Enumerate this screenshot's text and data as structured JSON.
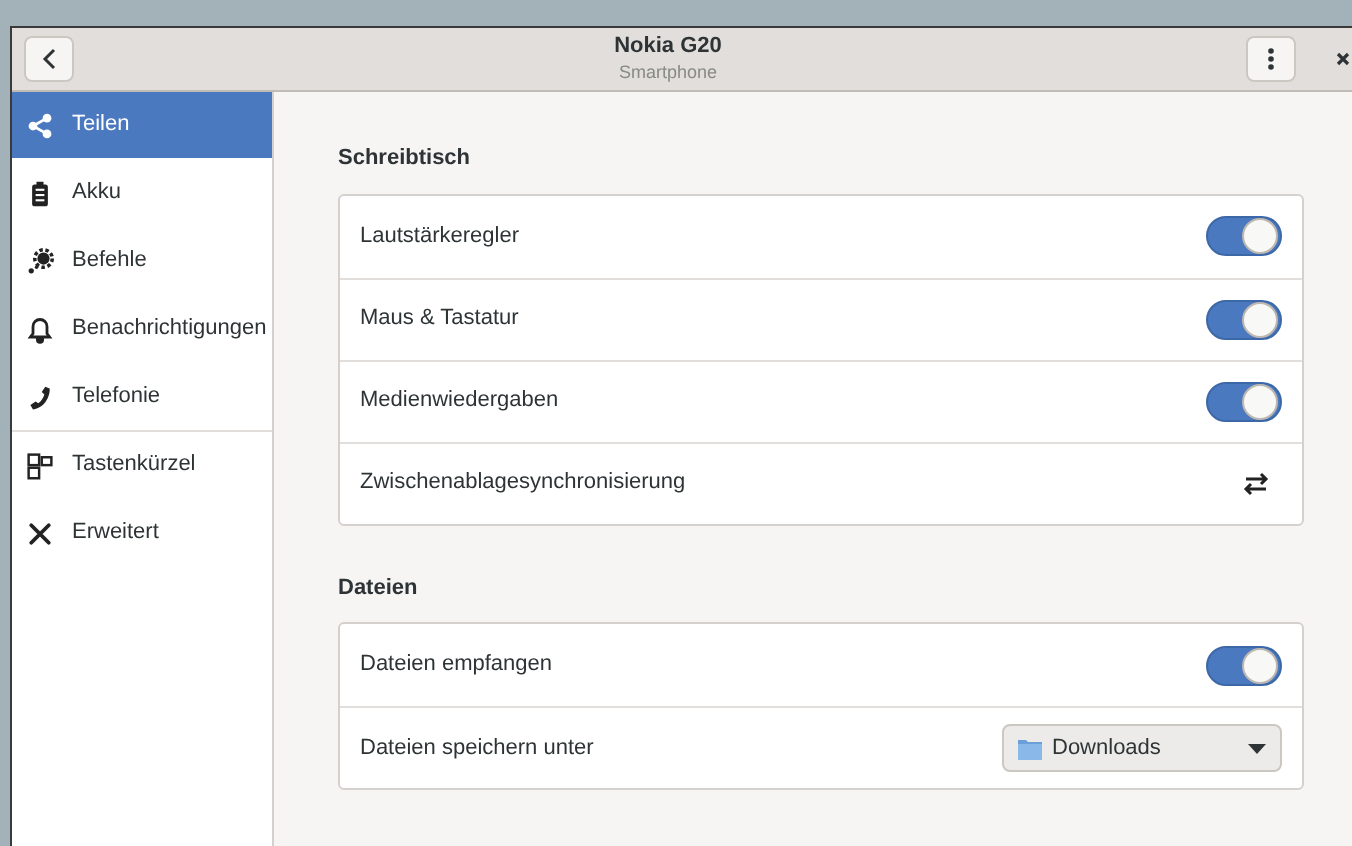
{
  "window": {
    "title": "Nokia G20",
    "subtitle": "Smartphone"
  },
  "sidebar": {
    "items": [
      {
        "label": "Teilen",
        "selected": true,
        "separator_after": false
      },
      {
        "label": "Akku",
        "selected": false,
        "separator_after": false
      },
      {
        "label": "Befehle",
        "selected": false,
        "separator_after": false
      },
      {
        "label": "Benachrichtigungen",
        "selected": false,
        "separator_after": false
      },
      {
        "label": "Telefonie",
        "selected": false,
        "separator_after": true
      },
      {
        "label": "Tastenkürzel",
        "selected": false,
        "separator_after": false
      },
      {
        "label": "Erweitert",
        "selected": false,
        "separator_after": false
      }
    ]
  },
  "sections": [
    {
      "title": "Schreibtisch",
      "rows": [
        {
          "kind": "switch",
          "label": "Lautstärkeregler",
          "on": true
        },
        {
          "kind": "switch",
          "label": "Maus & Tastatur",
          "on": true
        },
        {
          "kind": "switch",
          "label": "Medienwiedergaben",
          "on": true
        },
        {
          "kind": "action",
          "label": "Zwischenablagesynchronisierung"
        }
      ]
    },
    {
      "title": "Dateien",
      "rows": [
        {
          "kind": "switch",
          "label": "Dateien empfangen",
          "on": true
        },
        {
          "kind": "dropdown",
          "label": "Dateien speichern unter",
          "value": "Downloads"
        }
      ]
    }
  ]
}
